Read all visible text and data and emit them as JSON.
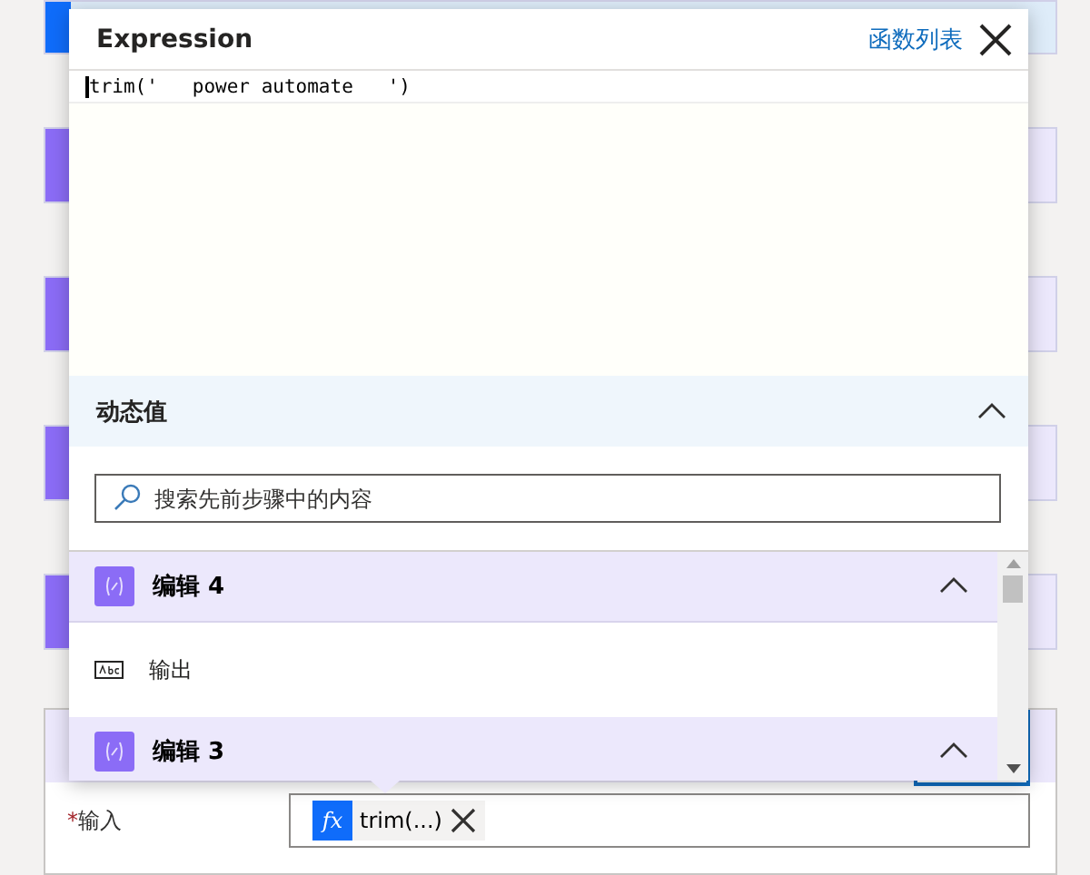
{
  "expression": {
    "title": "Expression",
    "link": "函数列表",
    "code": "trim('   power automate   ')"
  },
  "dynamic": {
    "title": "动态值",
    "expanded": true,
    "search": {
      "placeholder": "搜索先前步骤中的内容"
    },
    "groups": [
      {
        "title": "编辑 4",
        "expanded": true,
        "items": [
          {
            "label": "输出"
          }
        ]
      },
      {
        "title": "编辑 3",
        "expanded": true
      }
    ]
  },
  "action": {
    "label": "输入",
    "required": true,
    "required_mark": "*",
    "token": {
      "icon": "fx",
      "text": "trim(...)"
    }
  }
}
